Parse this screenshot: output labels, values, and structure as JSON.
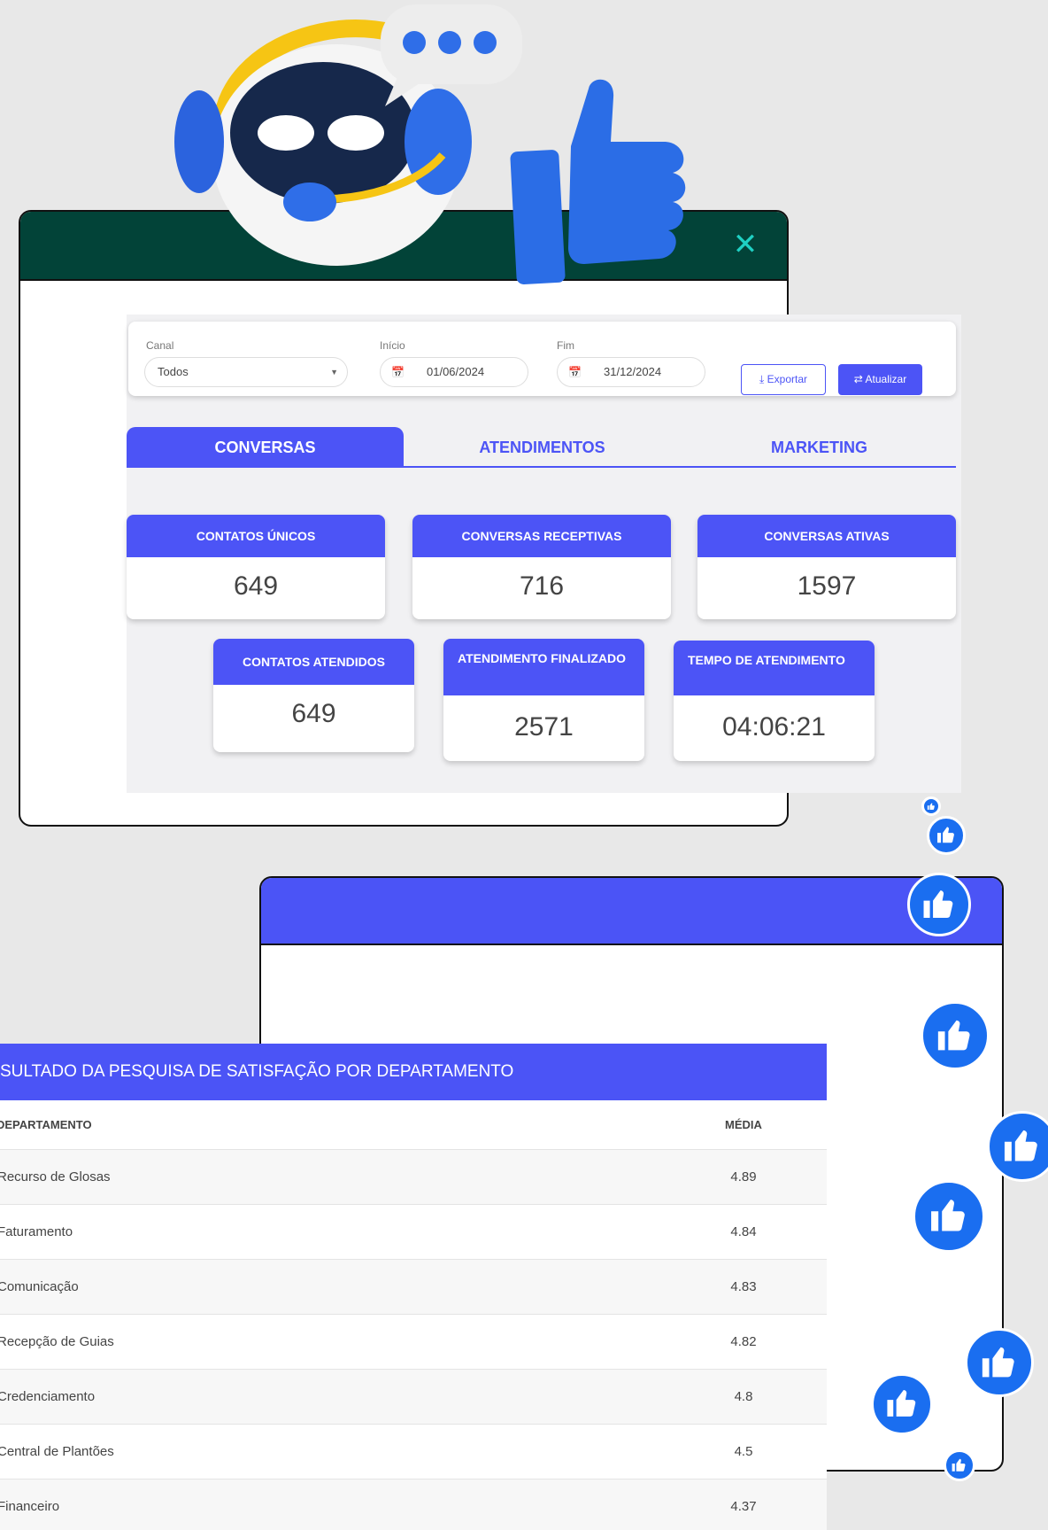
{
  "window1": {
    "filters": {
      "canal_label": "Canal",
      "canal_value": "Todos",
      "inicio_label": "Início",
      "inicio_value": "01/06/2024",
      "fim_label": "Fim",
      "fim_value": "31/12/2024",
      "export_label": "Exportar",
      "update_label": "Atualizar"
    },
    "tabs": [
      "CONVERSAS",
      "ATENDIMENTOS",
      "MARKETING"
    ],
    "metrics_top": [
      {
        "label": "CONTATOS ÚNICOS",
        "value": "649"
      },
      {
        "label": "CONVERSAS RECEPTIVAS",
        "value": "716"
      },
      {
        "label": "CONVERSAS ATIVAS",
        "value": "1597"
      }
    ],
    "metrics_bottom": [
      {
        "label": "CONTATOS ATENDIDOS",
        "value": "649"
      },
      {
        "label": "ATENDIMENTO FINALIZADO",
        "value": "2571"
      },
      {
        "label": "TEMPO DE ATENDIMENTO",
        "value": "04:06:21"
      }
    ]
  },
  "table": {
    "title": "SULTADO DA PESQUISA DE SATISFAÇÃO POR DEPARTAMENTO",
    "col_department": "DEPARTAMENTO",
    "col_average": "MÉDIA",
    "rows": [
      {
        "department": "Recurso de Glosas",
        "average": "4.89"
      },
      {
        "department": "Faturamento",
        "average": "4.84"
      },
      {
        "department": "Comunicação",
        "average": "4.83"
      },
      {
        "department": "Recepção de Guias",
        "average": "4.82"
      },
      {
        "department": "Credenciamento",
        "average": "4.8"
      },
      {
        "department": "Central de Plantões",
        "average": "4.5"
      },
      {
        "department": "Financeiro",
        "average": "4.37"
      }
    ]
  },
  "icons": {
    "close": "close-icon",
    "robot": "robot-mascot",
    "thumb": "thumbs-up-icon",
    "calendar": "calendar-icon",
    "download": "download-icon",
    "refresh": "swap-icon"
  },
  "colors": {
    "primary": "#4c54f6",
    "header_green": "#024338",
    "like_blue": "#1a6ef0"
  }
}
